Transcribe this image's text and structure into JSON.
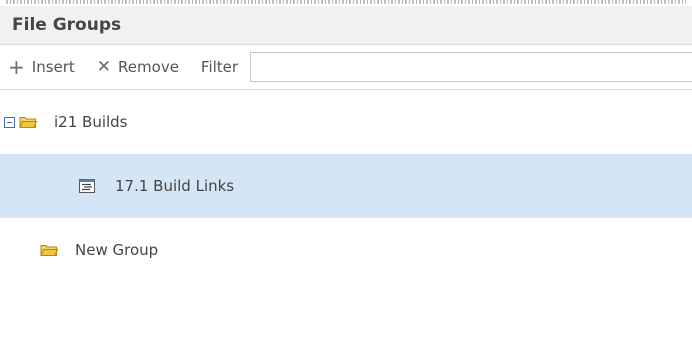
{
  "panel": {
    "title": "File Groups"
  },
  "toolbar": {
    "insert_label": "Insert",
    "remove_label": "Remove",
    "filter_label": "Filter",
    "filter_value": ""
  },
  "tree": {
    "items": [
      {
        "label": "i21 Builds",
        "icon": "folder-open-icon",
        "expanded": true,
        "selected": false
      },
      {
        "label": "17.1 Build Links",
        "icon": "document-list-icon",
        "selected": true
      },
      {
        "label": "New Group",
        "icon": "folder-open-icon",
        "selected": false
      }
    ]
  },
  "colors": {
    "header_bg": "#f1f1f1",
    "selected_bg": "#d4e6f5",
    "folder_yellow": "#f3c43f",
    "expander_blue": "#3f6ea8"
  }
}
